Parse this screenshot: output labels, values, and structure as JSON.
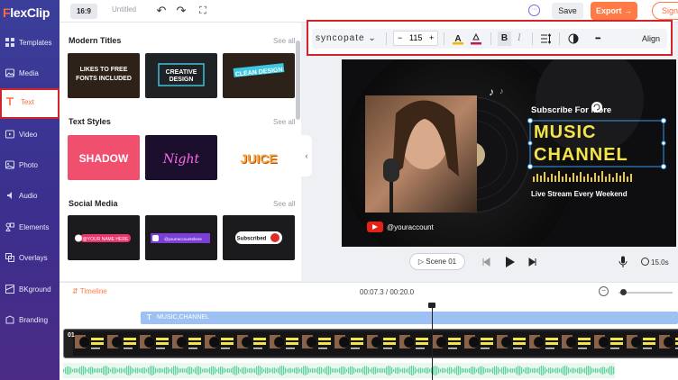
{
  "app": {
    "logo_prefix": "F",
    "logo_rest": "lexClip",
    "title_placeholder": "Untitled"
  },
  "colors": {
    "accent": "#ff7a45",
    "sidebar": "#3b3592",
    "highlight": "#d0232a"
  },
  "sidebar": {
    "items": [
      {
        "label": "Templates",
        "icon": "templates-icon"
      },
      {
        "label": "Media",
        "icon": "media-icon"
      },
      {
        "label": "Text",
        "icon": "text-icon"
      },
      {
        "label": "Video",
        "icon": "video-icon"
      },
      {
        "label": "Photo",
        "icon": "photo-icon"
      },
      {
        "label": "Audio",
        "icon": "audio-icon"
      },
      {
        "label": "Elements",
        "icon": "elements-icon"
      },
      {
        "label": "Overlays",
        "icon": "overlays-icon"
      },
      {
        "label": "BKground",
        "icon": "background-icon"
      },
      {
        "label": "Branding",
        "icon": "branding-icon"
      }
    ]
  },
  "topbar": {
    "ratio": "16:9",
    "title": "Untitled",
    "save": "Save",
    "export": "Export",
    "sign": "Sign"
  },
  "panel": {
    "see_all": "See all",
    "sections": [
      {
        "title": "Modern Titles",
        "items": [
          "LIKES TO FREE FONTS INCLUDED",
          "CREATIVE DESIGN",
          "CLEAN DESIGN"
        ]
      },
      {
        "title": "Text Styles",
        "items": [
          "SHADOW",
          "Night",
          "JUICE"
        ]
      },
      {
        "title": "Social Media",
        "items": [
          "@YOUR NAME HERE",
          "@yourraccountshere",
          "Subscribed"
        ]
      }
    ]
  },
  "toolbar": {
    "font": "syncopate",
    "size": "115",
    "minus": "−",
    "plus": "+",
    "bold": "B",
    "italic": "I",
    "align": "Align",
    "more": "•••"
  },
  "canvas": {
    "subscribe": "Subscribe For More",
    "title_line1": "MUSIC",
    "title_line2": "CHANNEL",
    "subtitle": "Live Stream Every Weekend",
    "account": "@youraccount"
  },
  "stage": {
    "scene": "Scene 01",
    "duration": "15.0s"
  },
  "timeline": {
    "label": "Timeline",
    "time": "00:07.3 / 00:20.0",
    "text_track": "MUSIC,CHANNEL",
    "clip_number": "01"
  }
}
